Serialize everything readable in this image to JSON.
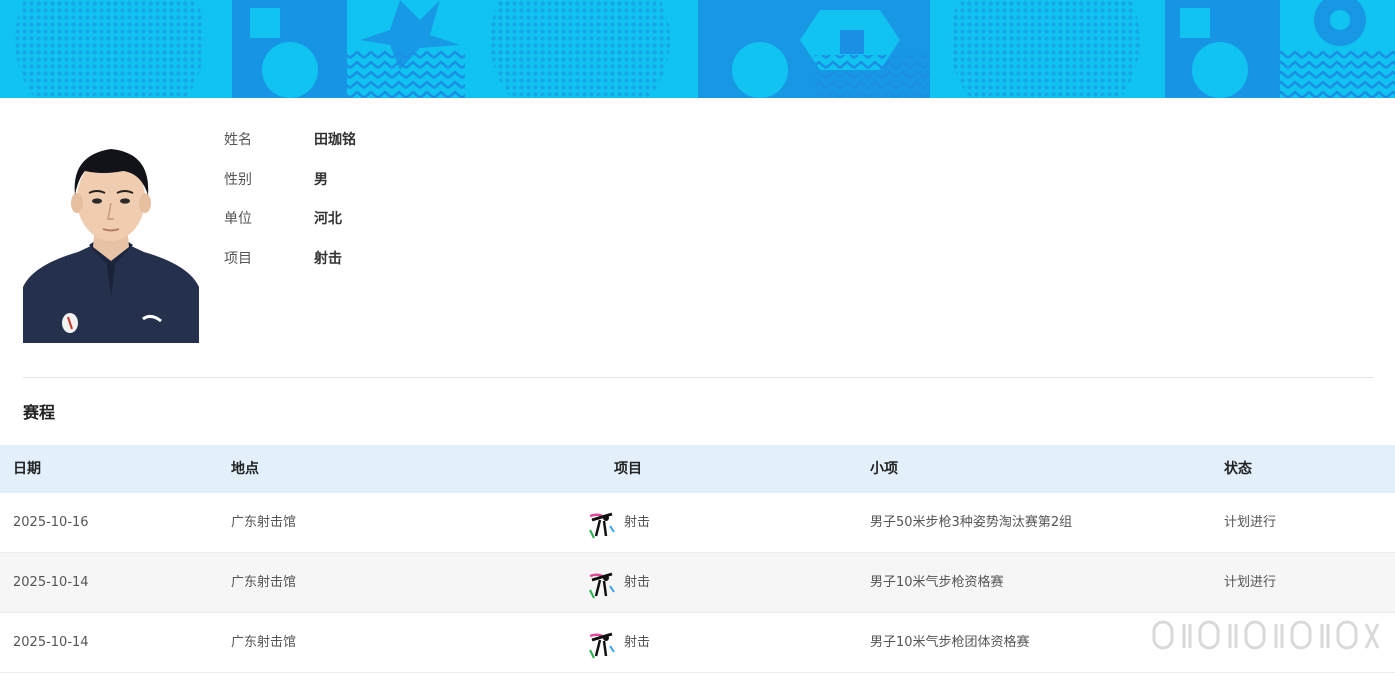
{
  "profile": {
    "fields": [
      {
        "label": "姓名",
        "value": "田珈铭"
      },
      {
        "label": "性别",
        "value": "男"
      },
      {
        "label": "单位",
        "value": "河北"
      },
      {
        "label": "项目",
        "value": "射击"
      }
    ]
  },
  "schedule": {
    "title": "赛程",
    "columns": {
      "date": "日期",
      "venue": "地点",
      "sport": "项目",
      "event": "小项",
      "status": "状态"
    },
    "rows": [
      {
        "date": "2025-10-16",
        "venue": "广东射击馆",
        "sport": "射击",
        "event": "男子50米步枪3种姿势淘汰赛第2组",
        "status": "计划进行"
      },
      {
        "date": "2025-10-14",
        "venue": "广东射击馆",
        "sport": "射击",
        "event": "男子10米气步枪资格赛",
        "status": "计划进行"
      },
      {
        "date": "2025-10-14",
        "venue": "广东射击馆",
        "sport": "射击",
        "event": "男子10米气步枪团体资格赛",
        "status": ""
      }
    ]
  },
  "colors": {
    "banner_base": "#11c3f0",
    "banner_dark": "#1a8fe3",
    "table_header_bg": "#e3f0fc",
    "row_alt_bg": "#f6f6f6"
  },
  "icons": {
    "sport": "shooting-icon",
    "watermark": "weibo-watermark"
  }
}
